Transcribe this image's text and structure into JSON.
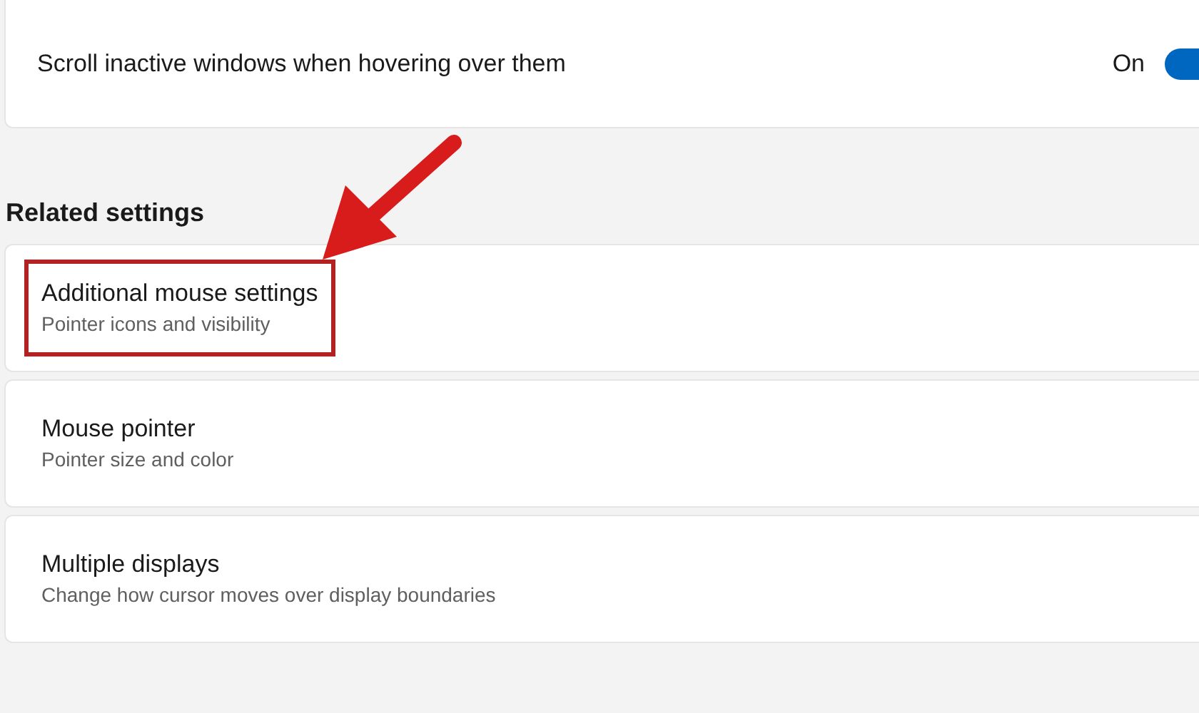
{
  "top_setting": {
    "label": "Scroll inactive windows when hovering over them",
    "state_text": "On",
    "on": true
  },
  "related": {
    "heading": "Related settings",
    "items": [
      {
        "title": "Additional mouse settings",
        "subtitle": "Pointer icons and visibility",
        "highlighted": true
      },
      {
        "title": "Mouse pointer",
        "subtitle": "Pointer size and color",
        "highlighted": false
      },
      {
        "title": "Multiple displays",
        "subtitle": "Change how cursor moves over display boundaries",
        "highlighted": false
      }
    ]
  }
}
